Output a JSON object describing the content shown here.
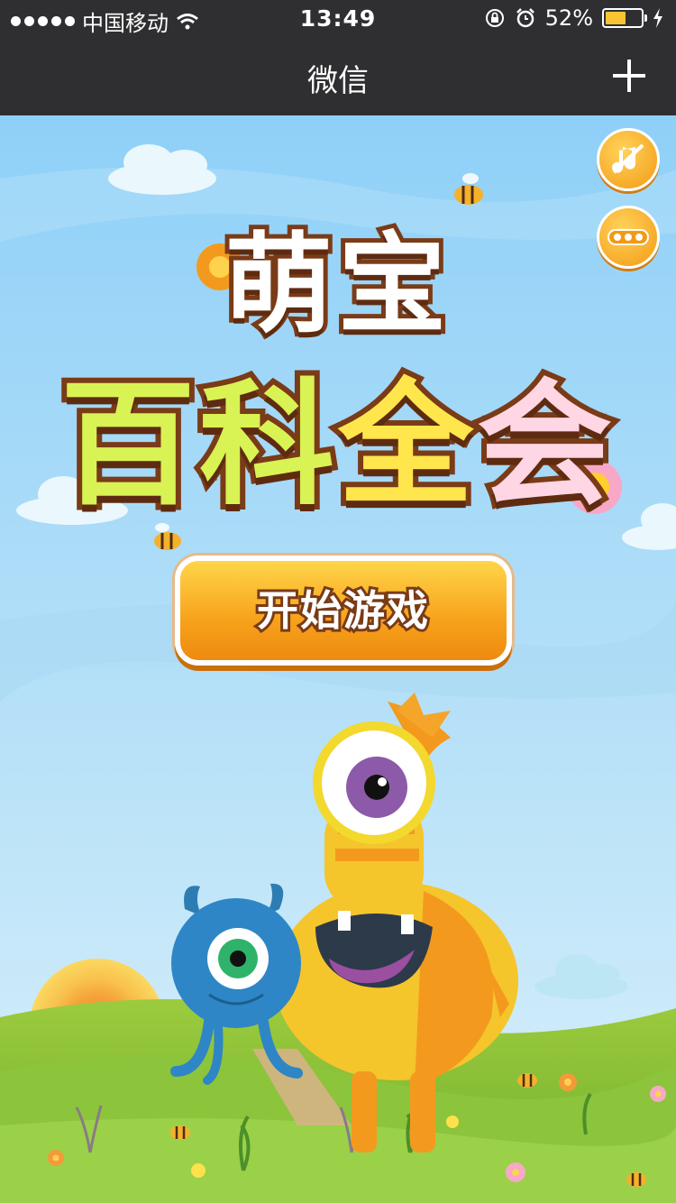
{
  "status_bar": {
    "carrier": "中国移动",
    "time": "13:49",
    "battery_percent": "52%"
  },
  "nav": {
    "title": "微信"
  },
  "game": {
    "title_line1": "萌宝",
    "title_line2": [
      "百",
      "科",
      "全",
      "会"
    ],
    "start_label": "开始游戏"
  },
  "colors": {
    "nav_bg": "#2f2f31",
    "sky": "#9fd6f6",
    "grass": "#8cc43c",
    "start_button": "#f7a21b",
    "title_outline": "#7a3b17"
  },
  "icons": [
    "signal-dots-icon",
    "wifi-icon",
    "rotation-lock-icon",
    "alarm-icon",
    "battery-icon",
    "charging-bolt-icon",
    "plus-icon",
    "mute-music-icon",
    "more-icon",
    "bee-icon",
    "flower-icon",
    "yellow-monster",
    "blue-monster",
    "sun-icon",
    "cloud-icon"
  ]
}
